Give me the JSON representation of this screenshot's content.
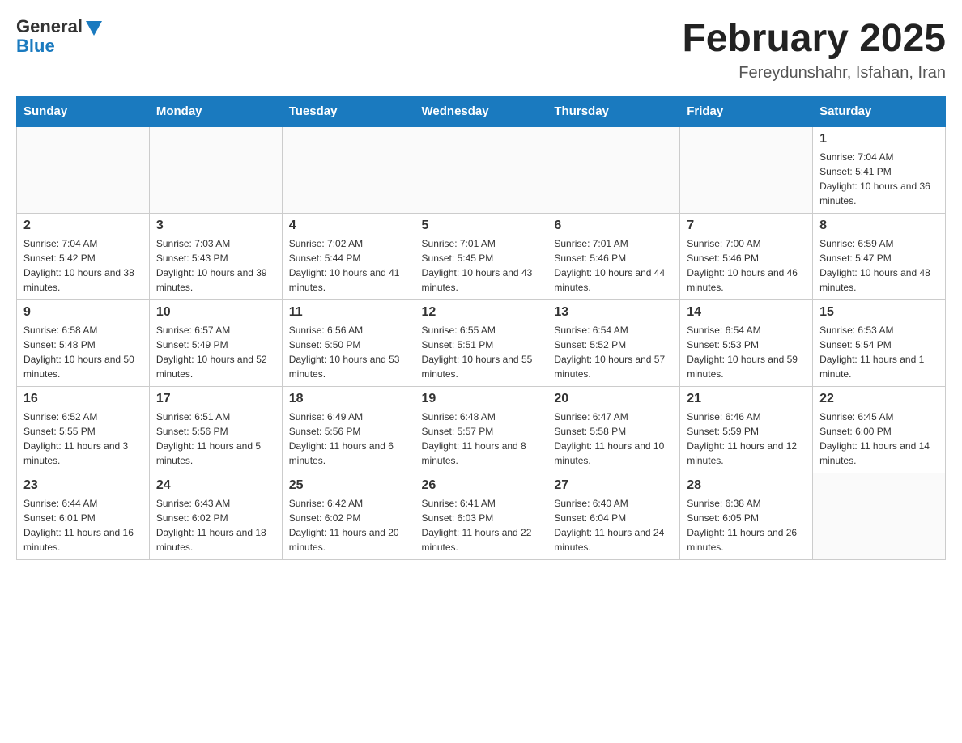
{
  "header": {
    "logo": {
      "general": "General",
      "blue": "Blue"
    },
    "title": "February 2025",
    "subtitle": "Fereydunshahr, Isfahan, Iran"
  },
  "days_of_week": [
    "Sunday",
    "Monday",
    "Tuesday",
    "Wednesday",
    "Thursday",
    "Friday",
    "Saturday"
  ],
  "weeks": [
    [
      {
        "day": "",
        "info": ""
      },
      {
        "day": "",
        "info": ""
      },
      {
        "day": "",
        "info": ""
      },
      {
        "day": "",
        "info": ""
      },
      {
        "day": "",
        "info": ""
      },
      {
        "day": "",
        "info": ""
      },
      {
        "day": "1",
        "info": "Sunrise: 7:04 AM\nSunset: 5:41 PM\nDaylight: 10 hours and 36 minutes."
      }
    ],
    [
      {
        "day": "2",
        "info": "Sunrise: 7:04 AM\nSunset: 5:42 PM\nDaylight: 10 hours and 38 minutes."
      },
      {
        "day": "3",
        "info": "Sunrise: 7:03 AM\nSunset: 5:43 PM\nDaylight: 10 hours and 39 minutes."
      },
      {
        "day": "4",
        "info": "Sunrise: 7:02 AM\nSunset: 5:44 PM\nDaylight: 10 hours and 41 minutes."
      },
      {
        "day": "5",
        "info": "Sunrise: 7:01 AM\nSunset: 5:45 PM\nDaylight: 10 hours and 43 minutes."
      },
      {
        "day": "6",
        "info": "Sunrise: 7:01 AM\nSunset: 5:46 PM\nDaylight: 10 hours and 44 minutes."
      },
      {
        "day": "7",
        "info": "Sunrise: 7:00 AM\nSunset: 5:46 PM\nDaylight: 10 hours and 46 minutes."
      },
      {
        "day": "8",
        "info": "Sunrise: 6:59 AM\nSunset: 5:47 PM\nDaylight: 10 hours and 48 minutes."
      }
    ],
    [
      {
        "day": "9",
        "info": "Sunrise: 6:58 AM\nSunset: 5:48 PM\nDaylight: 10 hours and 50 minutes."
      },
      {
        "day": "10",
        "info": "Sunrise: 6:57 AM\nSunset: 5:49 PM\nDaylight: 10 hours and 52 minutes."
      },
      {
        "day": "11",
        "info": "Sunrise: 6:56 AM\nSunset: 5:50 PM\nDaylight: 10 hours and 53 minutes."
      },
      {
        "day": "12",
        "info": "Sunrise: 6:55 AM\nSunset: 5:51 PM\nDaylight: 10 hours and 55 minutes."
      },
      {
        "day": "13",
        "info": "Sunrise: 6:54 AM\nSunset: 5:52 PM\nDaylight: 10 hours and 57 minutes."
      },
      {
        "day": "14",
        "info": "Sunrise: 6:54 AM\nSunset: 5:53 PM\nDaylight: 10 hours and 59 minutes."
      },
      {
        "day": "15",
        "info": "Sunrise: 6:53 AM\nSunset: 5:54 PM\nDaylight: 11 hours and 1 minute."
      }
    ],
    [
      {
        "day": "16",
        "info": "Sunrise: 6:52 AM\nSunset: 5:55 PM\nDaylight: 11 hours and 3 minutes."
      },
      {
        "day": "17",
        "info": "Sunrise: 6:51 AM\nSunset: 5:56 PM\nDaylight: 11 hours and 5 minutes."
      },
      {
        "day": "18",
        "info": "Sunrise: 6:49 AM\nSunset: 5:56 PM\nDaylight: 11 hours and 6 minutes."
      },
      {
        "day": "19",
        "info": "Sunrise: 6:48 AM\nSunset: 5:57 PM\nDaylight: 11 hours and 8 minutes."
      },
      {
        "day": "20",
        "info": "Sunrise: 6:47 AM\nSunset: 5:58 PM\nDaylight: 11 hours and 10 minutes."
      },
      {
        "day": "21",
        "info": "Sunrise: 6:46 AM\nSunset: 5:59 PM\nDaylight: 11 hours and 12 minutes."
      },
      {
        "day": "22",
        "info": "Sunrise: 6:45 AM\nSunset: 6:00 PM\nDaylight: 11 hours and 14 minutes."
      }
    ],
    [
      {
        "day": "23",
        "info": "Sunrise: 6:44 AM\nSunset: 6:01 PM\nDaylight: 11 hours and 16 minutes."
      },
      {
        "day": "24",
        "info": "Sunrise: 6:43 AM\nSunset: 6:02 PM\nDaylight: 11 hours and 18 minutes."
      },
      {
        "day": "25",
        "info": "Sunrise: 6:42 AM\nSunset: 6:02 PM\nDaylight: 11 hours and 20 minutes."
      },
      {
        "day": "26",
        "info": "Sunrise: 6:41 AM\nSunset: 6:03 PM\nDaylight: 11 hours and 22 minutes."
      },
      {
        "day": "27",
        "info": "Sunrise: 6:40 AM\nSunset: 6:04 PM\nDaylight: 11 hours and 24 minutes."
      },
      {
        "day": "28",
        "info": "Sunrise: 6:38 AM\nSunset: 6:05 PM\nDaylight: 11 hours and 26 minutes."
      },
      {
        "day": "",
        "info": ""
      }
    ]
  ]
}
